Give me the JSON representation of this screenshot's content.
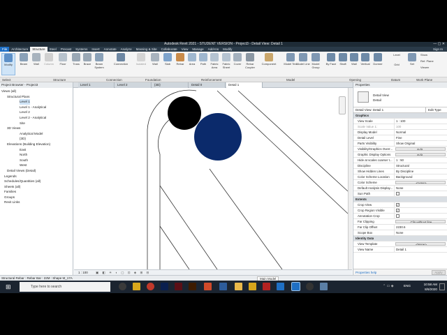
{
  "window": {
    "title": "Autodesk Revit 2021 - STUDENT VERSION - Project3 - Detail View: Detail 1",
    "sign_in": "Sign In"
  },
  "menu": [
    "File",
    "Architecture",
    "Structure",
    "Steel",
    "Precast",
    "Systems",
    "Insert",
    "Annotate",
    "Analyze",
    "Massing & Site",
    "Collaborate",
    "View",
    "Manage",
    "Add-Ins",
    "Modify"
  ],
  "ribbon": {
    "buttons": [
      "Modify",
      "Beam",
      "Wall",
      "Column",
      "Floor",
      "Truss",
      "Brace",
      "Beam System",
      "Connection",
      "Isolated",
      "Wall",
      "Slab",
      "Rebar",
      "Area",
      "Path",
      "Fabric Area",
      "Fabric Sheet",
      "Cover",
      "Rebar Coupler",
      "Component",
      "Model Text",
      "Model Line",
      "Model Group",
      "By Face",
      "Shaft",
      "Wall",
      "Vertical",
      "Dormer",
      "Level",
      "Grid",
      "Set",
      "Show",
      "Ref. Plane",
      "Viewer"
    ],
    "panels": [
      "Select",
      "Structure",
      "Connection",
      "Foundation",
      "Reinforcement",
      "Model",
      "Opening",
      "Datum",
      "Work Plane"
    ]
  },
  "project_browser": {
    "title": "Project Browser - Project3",
    "items": [
      "Views (all)",
      "Structural Plans",
      "Level 1",
      "Level 1 - Analytical",
      "Level 2",
      "Level 2 - Analytical",
      "Site",
      "3D Views",
      "Analytical Model",
      "{3D}",
      "Elevations (Building Elevation)",
      "East",
      "North",
      "South",
      "West",
      "Detail Views (Detail)",
      "Legends",
      "Schedules/Quantities (all)",
      "Sheets (all)",
      "Families",
      "Groups",
      "Revit Links"
    ]
  },
  "view_tabs": [
    "Level 1",
    "Level 2",
    "{3D}",
    "Detail 0",
    "Detail 1"
  ],
  "view_bar": {
    "scale": "1 : 100"
  },
  "properties": {
    "title": "Properties",
    "type_name": "Detail View",
    "type_sub": "Detail",
    "instance_select": "Detail View: Detail 1",
    "edit_type": "Edit Type",
    "groups": [
      {
        "name": "Graphics",
        "rows": [
          {
            "k": "View Scale",
            "v": "1 : 100"
          },
          {
            "k": "Scale Value 1:",
            "v": "100"
          },
          {
            "k": "Display Model",
            "v": "Normal"
          },
          {
            "k": "Detail Level",
            "v": "Fine"
          },
          {
            "k": "Parts Visibility",
            "v": "Show Original"
          },
          {
            "k": "Visibility/Graphics Overr...",
            "v": "Edit..."
          },
          {
            "k": "Graphic Display Options",
            "v": "Edit..."
          },
          {
            "k": "Hide at scales coarser t...",
            "v": "1 : 50"
          },
          {
            "k": "Discipline",
            "v": "Structural"
          },
          {
            "k": "Show Hidden Lines",
            "v": "By Discipline"
          },
          {
            "k": "Color Scheme Location",
            "v": "Background"
          },
          {
            "k": "Color Scheme",
            "v": "<none>"
          },
          {
            "k": "Default Analysis Display...",
            "v": "None"
          },
          {
            "k": "Sun Path",
            "v": ""
          }
        ]
      },
      {
        "name": "Extents",
        "rows": [
          {
            "k": "Crop View",
            "v": "✓"
          },
          {
            "k": "Crop Region Visible",
            "v": "✓"
          },
          {
            "k": "Annotation Crop",
            "v": ""
          },
          {
            "k": "Far Clipping",
            "v": "Clip without line"
          },
          {
            "k": "Far Clip Offset",
            "v": "2230.6"
          },
          {
            "k": "Scope Box",
            "v": "None"
          }
        ]
      },
      {
        "name": "Identity Data",
        "rows": [
          {
            "k": "View Template",
            "v": "<None>"
          },
          {
            "k": "View Name",
            "v": "Detail 1"
          }
        ]
      }
    ],
    "help": "Properties help",
    "apply": "Apply"
  },
  "status_bar": {
    "text": "Structural Rebar : Rebar Bar : 22M : Shape M_17A",
    "model": "Main Model"
  },
  "taskbar": {
    "search_placeholder": "Type here to search",
    "time": "10:58 AM",
    "date": "8/6/2020",
    "lang": "ENG"
  },
  "colors": {
    "rebar_black": "#000000",
    "rebar_navy": "#0b2a6b",
    "accent": "#1f6fc4"
  }
}
